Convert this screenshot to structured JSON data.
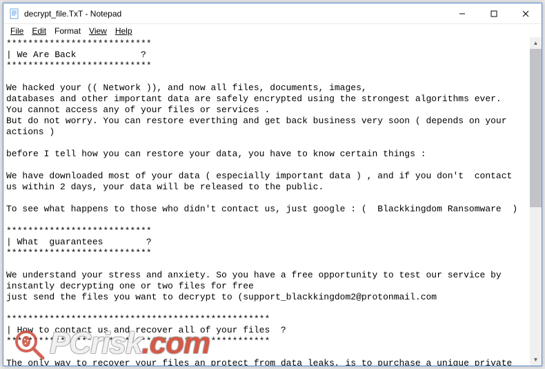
{
  "window": {
    "title": "decrypt_file.TxT - Notepad"
  },
  "menu": {
    "file": "File",
    "edit": "Edit",
    "format": "Format",
    "view": "View",
    "help": "Help"
  },
  "body_text": "***************************\n| We Are Back            ?\n***************************\n\nWe hacked your (( Network )), and now all files, documents, images,\ndatabases and other important data are safely encrypted using the strongest algorithms ever.\nYou cannot access any of your files or services .\nBut do not worry. You can restore everthing and get back business very soon ( depends on your actions )\n\nbefore I tell how you can restore your data, you have to know certain things :\n\nWe have downloaded most of your data ( especially important data ) , and if you don't  contact us within 2 days, your data will be released to the public.\n\nTo see what happens to those who didn't contact us, just google : (  Blackkingdom Ransomware  )\n\n***************************\n| What  guarantees        ?\n***************************\n\nWe understand your stress and anxiety. So you have a free opportunity to test our service by instantly decrypting one or two files for free\njust send the files you want to decrypt to (support_blackkingdom2@protonmail.com\n\n*************************************************\n| How to contact us and recover all of your files  ?\n*************************************************\n\nThe only way to recover your files an protect from data leaks, is to purchase a unique private key",
  "watermark": {
    "brand": "PCrisk",
    "suffix": ".com"
  }
}
